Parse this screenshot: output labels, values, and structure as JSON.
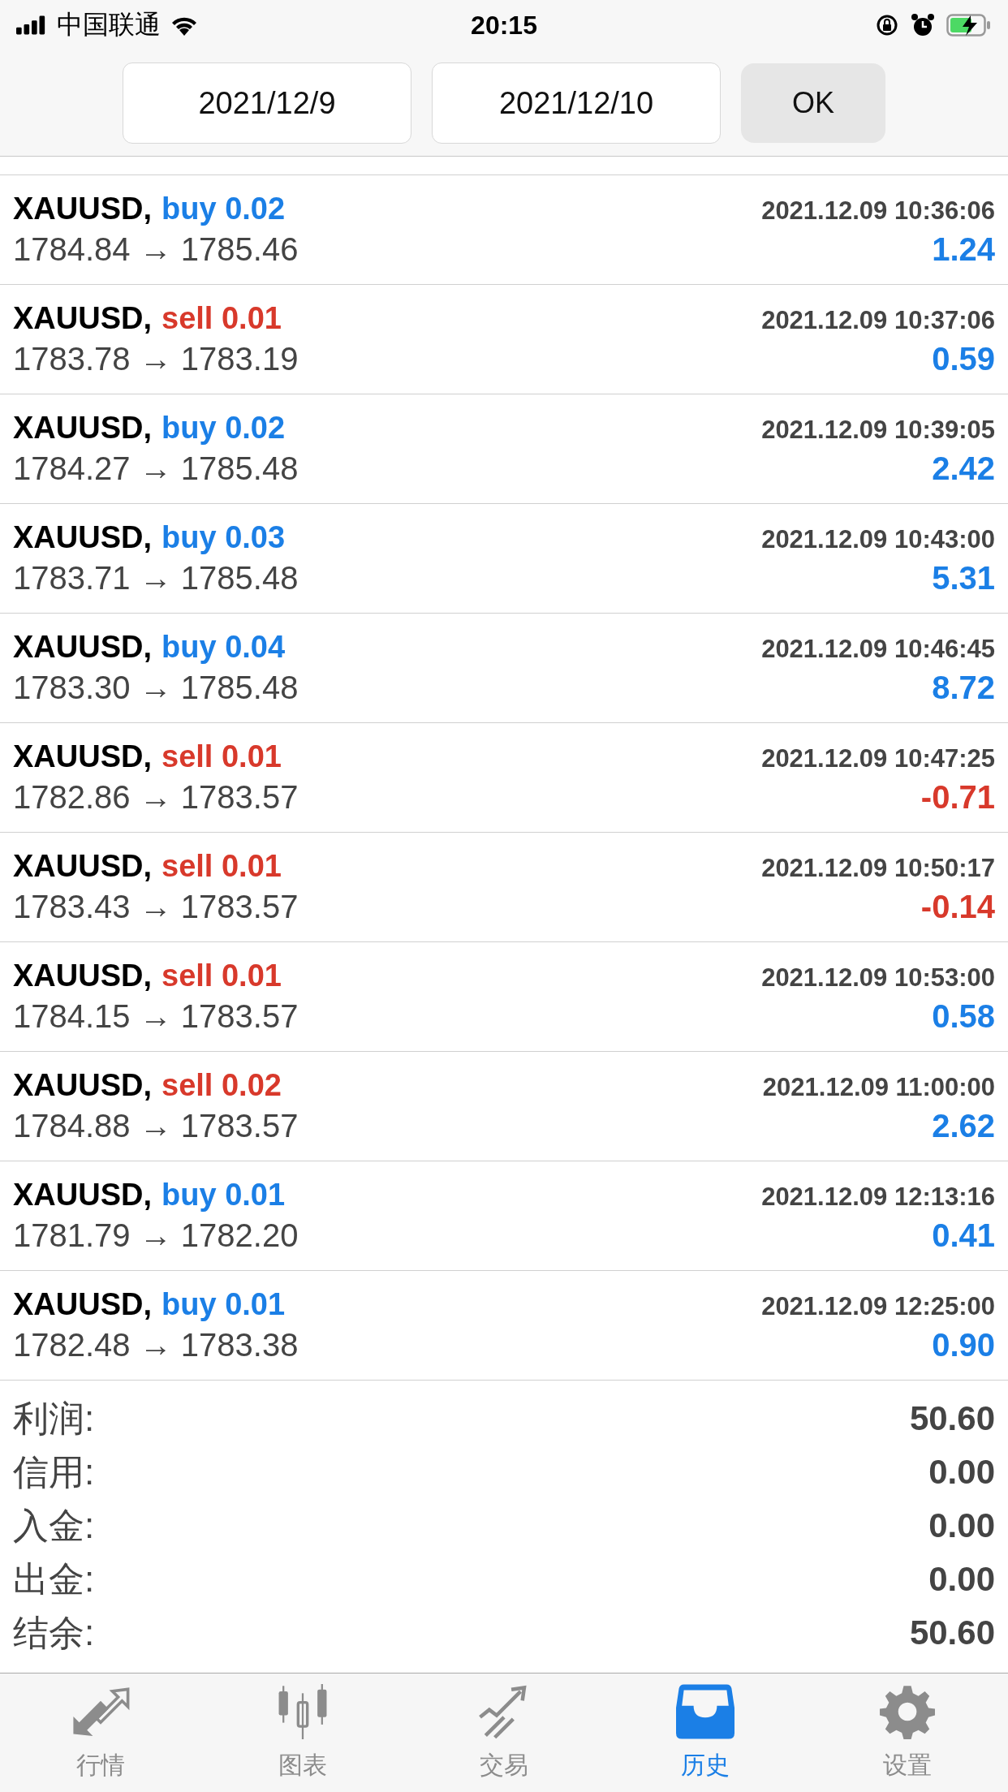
{
  "status_bar": {
    "carrier": "中国联通",
    "time": "20:15"
  },
  "date_range": {
    "from": "2021/12/9",
    "to": "2021/12/10",
    "button": "OK"
  },
  "deals": [
    {
      "symbol": "XAUUSD,",
      "kind": "buy",
      "side": "buy 0.02",
      "time": "2021.12.09 10:36:06",
      "prices": "1784.84 → 1785.46",
      "profit": "1.24",
      "negative": false
    },
    {
      "symbol": "XAUUSD,",
      "kind": "sell",
      "side": "sell 0.01",
      "time": "2021.12.09 10:37:06",
      "prices": "1783.78 → 1783.19",
      "profit": "0.59",
      "negative": false
    },
    {
      "symbol": "XAUUSD,",
      "kind": "buy",
      "side": "buy 0.02",
      "time": "2021.12.09 10:39:05",
      "prices": "1784.27 → 1785.48",
      "profit": "2.42",
      "negative": false
    },
    {
      "symbol": "XAUUSD,",
      "kind": "buy",
      "side": "buy 0.03",
      "time": "2021.12.09 10:43:00",
      "prices": "1783.71 → 1785.48",
      "profit": "5.31",
      "negative": false
    },
    {
      "symbol": "XAUUSD,",
      "kind": "buy",
      "side": "buy 0.04",
      "time": "2021.12.09 10:46:45",
      "prices": "1783.30 → 1785.48",
      "profit": "8.72",
      "negative": false
    },
    {
      "symbol": "XAUUSD,",
      "kind": "sell",
      "side": "sell 0.01",
      "time": "2021.12.09 10:47:25",
      "prices": "1782.86 → 1783.57",
      "profit": "-0.71",
      "negative": true
    },
    {
      "symbol": "XAUUSD,",
      "kind": "sell",
      "side": "sell 0.01",
      "time": "2021.12.09 10:50:17",
      "prices": "1783.43 → 1783.57",
      "profit": "-0.14",
      "negative": true
    },
    {
      "symbol": "XAUUSD,",
      "kind": "sell",
      "side": "sell 0.01",
      "time": "2021.12.09 10:53:00",
      "prices": "1784.15 → 1783.57",
      "profit": "0.58",
      "negative": false
    },
    {
      "symbol": "XAUUSD,",
      "kind": "sell",
      "side": "sell 0.02",
      "time": "2021.12.09 11:00:00",
      "prices": "1784.88 → 1783.57",
      "profit": "2.62",
      "negative": false
    },
    {
      "symbol": "XAUUSD,",
      "kind": "buy",
      "side": "buy 0.01",
      "time": "2021.12.09 12:13:16",
      "prices": "1781.79 → 1782.20",
      "profit": "0.41",
      "negative": false
    },
    {
      "symbol": "XAUUSD,",
      "kind": "buy",
      "side": "buy 0.01",
      "time": "2021.12.09 12:25:00",
      "prices": "1782.48 → 1783.38",
      "profit": "0.90",
      "negative": false
    }
  ],
  "summary": [
    {
      "label": "利润:",
      "value": "50.60"
    },
    {
      "label": "信用:",
      "value": "0.00"
    },
    {
      "label": "入金:",
      "value": "0.00"
    },
    {
      "label": "出金:",
      "value": "0.00"
    },
    {
      "label": "结余:",
      "value": "50.60"
    }
  ],
  "tabs": [
    {
      "label": "行情",
      "kind": "quotes",
      "selected": false
    },
    {
      "label": "图表",
      "kind": "chart",
      "selected": false
    },
    {
      "label": "交易",
      "kind": "trade",
      "selected": false
    },
    {
      "label": "历史",
      "kind": "history",
      "selected": true
    },
    {
      "label": "设置",
      "kind": "settings",
      "selected": false
    }
  ]
}
